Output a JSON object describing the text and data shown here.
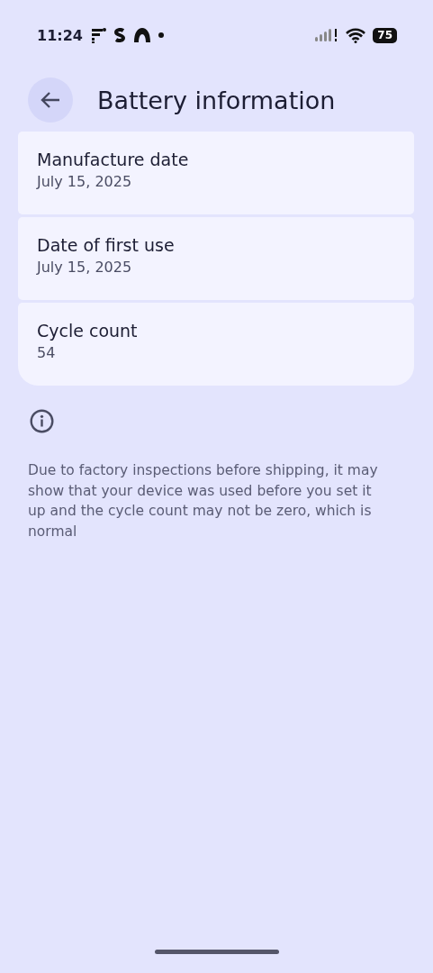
{
  "status_bar": {
    "time": "11:24",
    "battery": "75"
  },
  "header": {
    "title": "Battery information"
  },
  "items": [
    {
      "title": "Manufacture date",
      "value": "July 15, 2025"
    },
    {
      "title": "Date of first use",
      "value": "July 15, 2025"
    },
    {
      "title": "Cycle count",
      "value": "54"
    }
  ],
  "note": "Due to factory inspections before shipping, it may show that your device was used before you set it up and the cycle count may not be zero, which is normal"
}
